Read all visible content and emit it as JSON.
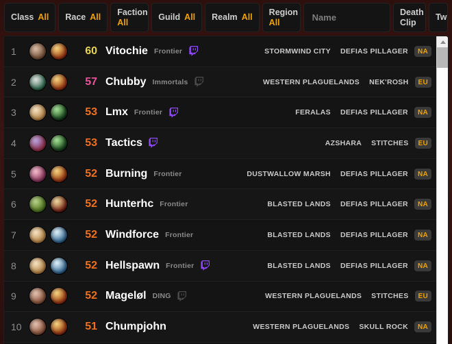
{
  "filters": [
    {
      "label": "Class",
      "value": "All",
      "layout": "inline",
      "name": "class"
    },
    {
      "label": "Race",
      "value": "All",
      "layout": "inline",
      "name": "race"
    },
    {
      "label": "Faction",
      "value": "All",
      "layout": "stacked",
      "name": "faction"
    },
    {
      "label": "Guild",
      "value": "All",
      "layout": "inline",
      "name": "guild"
    },
    {
      "label": "Realm",
      "value": "All",
      "layout": "inline",
      "name": "realm"
    },
    {
      "label": "Region",
      "value": "All",
      "layout": "stacked",
      "name": "region"
    }
  ],
  "search": {
    "placeholder": "Name",
    "value": ""
  },
  "death_clip_button": {
    "line1": "Death",
    "line2": "Clip"
  },
  "twitch_button": {
    "label": "Tw"
  },
  "colors": {
    "accent_gold": "#f0a202",
    "level_60": "#e8d44d",
    "level_high": "#e8539b",
    "level_mid": "#f0711a",
    "page_bg": "#2d100d",
    "row_bg": "#141414"
  },
  "scrollbar": {
    "position": "top",
    "orientation": "vertical"
  },
  "table": {
    "rows": [
      {
        "rank": "1",
        "level": "60",
        "level_color": "#e8d44d",
        "name": "Vitochie",
        "guild": "Frontier",
        "twitch": true,
        "twitch_active": true,
        "zone": "STORMWIND CITY",
        "realm": "DEFIAS PILLAGER",
        "region": "NA",
        "race_icon": "dwarf-male-portrait",
        "class_icon": "warrior-class-icon",
        "race_colors": [
          "#c9a183",
          "#6b4a33"
        ],
        "class_colors": [
          "#f2c14b",
          "#8a2b12"
        ]
      },
      {
        "rank": "2",
        "level": "57",
        "level_color": "#e8539b",
        "name": "Chubby",
        "guild": "Immortals",
        "twitch": true,
        "twitch_active": false,
        "zone": "WESTERN PLAGUELANDS",
        "realm": "NEK'ROSH",
        "region": "EU",
        "race_icon": "undead-female-portrait",
        "class_icon": "warrior-class-icon",
        "race_colors": [
          "#cfd6cf",
          "#1f5c44"
        ],
        "class_colors": [
          "#f2c14b",
          "#8a2b12"
        ]
      },
      {
        "rank": "3",
        "level": "53",
        "level_color": "#f0711a",
        "name": "Lmx",
        "guild": "Frontier",
        "twitch": true,
        "twitch_active": true,
        "zone": "FERALAS",
        "realm": "DEFIAS PILLAGER",
        "region": "NA",
        "race_icon": "human-female-portrait",
        "class_icon": "hunter-class-icon",
        "race_colors": [
          "#f3d7a8",
          "#a9793f"
        ],
        "class_colors": [
          "#7fd36b",
          "#14381a"
        ]
      },
      {
        "rank": "4",
        "level": "53",
        "level_color": "#f0711a",
        "name": "Tactics",
        "guild": "",
        "twitch": true,
        "twitch_active": true,
        "zone": "AZSHARA",
        "realm": "STITCHES",
        "region": "EU",
        "race_icon": "gnome-male-portrait",
        "class_icon": "hunter-class-icon",
        "race_colors": [
          "#9f7fd0",
          "#8c2b3c"
        ],
        "class_colors": [
          "#7fd36b",
          "#14381a"
        ]
      },
      {
        "rank": "5",
        "level": "52",
        "level_color": "#f0711a",
        "name": "Burning",
        "guild": "Frontier",
        "twitch": false,
        "twitch_active": false,
        "zone": "DUSTWALLOW MARSH",
        "realm": "DEFIAS PILLAGER",
        "region": "NA",
        "race_icon": "gnome-female-portrait",
        "class_icon": "warrior-class-icon",
        "race_colors": [
          "#f0a0b8",
          "#7a2c52"
        ],
        "class_colors": [
          "#f2c14b",
          "#8a2b12"
        ]
      },
      {
        "rank": "6",
        "level": "52",
        "level_color": "#f0711a",
        "name": "Hunterhc",
        "guild": "Frontier",
        "twitch": false,
        "twitch_active": false,
        "zone": "BLASTED LANDS",
        "realm": "DEFIAS PILLAGER",
        "region": "NA",
        "race_icon": "orc-male-portrait",
        "class_icon": "rogue-class-icon",
        "race_colors": [
          "#9bbf5a",
          "#4a6b1f"
        ],
        "class_colors": [
          "#e8c97a",
          "#6b1a12"
        ]
      },
      {
        "rank": "7",
        "level": "52",
        "level_color": "#f0711a",
        "name": "Windforce",
        "guild": "Frontier",
        "twitch": false,
        "twitch_active": false,
        "zone": "BLASTED LANDS",
        "realm": "DEFIAS PILLAGER",
        "region": "NA",
        "race_icon": "human-female-portrait",
        "class_icon": "paladin-class-icon",
        "race_colors": [
          "#f3d7a8",
          "#a9793f"
        ],
        "class_colors": [
          "#cfe9f7",
          "#2a5d86"
        ]
      },
      {
        "rank": "8",
        "level": "52",
        "level_color": "#f0711a",
        "name": "Hellspawn",
        "guild": "Frontier",
        "twitch": true,
        "twitch_active": true,
        "zone": "BLASTED LANDS",
        "realm": "DEFIAS PILLAGER",
        "region": "NA",
        "race_icon": "human-female-portrait",
        "class_icon": "paladin-class-icon",
        "race_colors": [
          "#f3d7a8",
          "#a9793f"
        ],
        "class_colors": [
          "#cfe9f7",
          "#2a5d86"
        ]
      },
      {
        "rank": "9",
        "level": "52",
        "level_color": "#f0711a",
        "name": "Mageløl",
        "guild": "DING",
        "twitch": true,
        "twitch_active": false,
        "zone": "WESTERN PLAGUELANDS",
        "realm": "STITCHES",
        "region": "EU",
        "race_icon": "dwarf-male-portrait",
        "class_icon": "warrior-class-icon",
        "race_colors": [
          "#d8a890",
          "#7d4a36"
        ],
        "class_colors": [
          "#f2c14b",
          "#8a2b12"
        ]
      },
      {
        "rank": "10",
        "level": "51",
        "level_color": "#f0711a",
        "name": "Chumpjohn",
        "guild": "",
        "twitch": false,
        "twitch_active": false,
        "zone": "WESTERN PLAGUELANDS",
        "realm": "SKULL ROCK",
        "region": "NA",
        "race_icon": "dwarf-male-portrait",
        "class_icon": "warrior-class-icon",
        "race_colors": [
          "#d8a890",
          "#7d4a36"
        ],
        "class_colors": [
          "#f2c14b",
          "#8a2b12"
        ]
      }
    ]
  }
}
